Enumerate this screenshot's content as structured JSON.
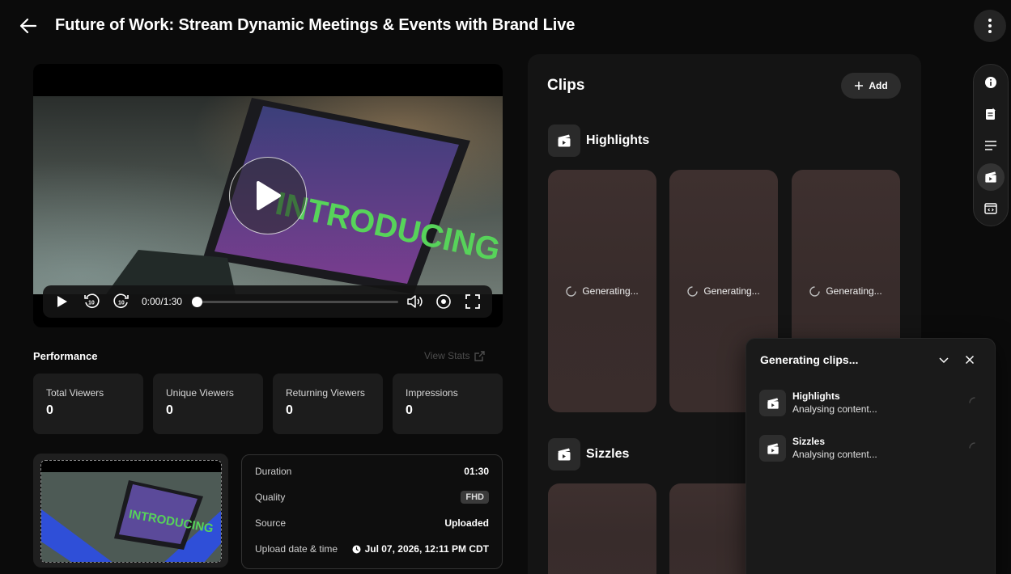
{
  "header": {
    "title": "Future of Work: Stream Dynamic Meetings & Events with Brand Live"
  },
  "player": {
    "time": "0:00/1:30",
    "progress": 0,
    "video_text": "INTRODUCING"
  },
  "performance": {
    "title": "Performance",
    "view_stats": "View Stats",
    "stats": [
      {
        "label": "Total Viewers",
        "value": "0"
      },
      {
        "label": "Unique Viewers",
        "value": "0"
      },
      {
        "label": "Returning Viewers",
        "value": "0"
      },
      {
        "label": "Impressions",
        "value": "0"
      }
    ]
  },
  "thumbnail": {
    "text": "INTRODUCING"
  },
  "info": [
    {
      "key": "Duration",
      "value": "01:30"
    },
    {
      "key": "Quality",
      "value": "FHD"
    },
    {
      "key": "Source",
      "value": "Uploaded"
    },
    {
      "key": "Upload date & time",
      "value": "Jul 07, 2026, 12:11 PM CDT"
    }
  ],
  "clips": {
    "title": "Clips",
    "add_label": "Add",
    "groups": [
      {
        "name": "Highlights",
        "cards": [
          "Generating...",
          "Generating...",
          "Generating..."
        ]
      },
      {
        "name": "Sizzles",
        "cards": []
      }
    ]
  },
  "rail": {
    "icons": [
      "info-icon",
      "transcript-icon",
      "chapters-icon",
      "clips-icon",
      "embed-icon"
    ],
    "active": "clips-icon"
  },
  "generating": {
    "title": "Generating clips...",
    "items": [
      {
        "name": "Highlights",
        "status": "Analysing content..."
      },
      {
        "name": "Sizzles",
        "status": "Analysing content..."
      }
    ]
  },
  "colors": {
    "background": "#0b0b0b",
    "card": "#1c1c1c",
    "clip_card": "#3e302f",
    "accent": "#ffffff"
  }
}
